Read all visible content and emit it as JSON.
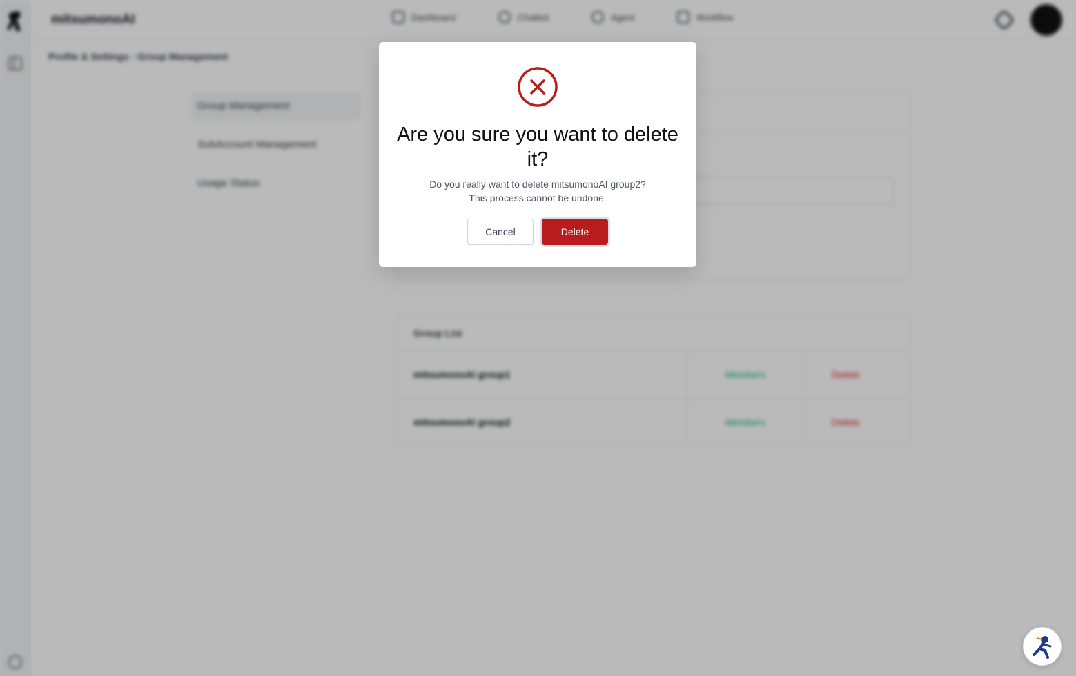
{
  "app": {
    "brand": "mitsumonoAI",
    "nav": [
      {
        "label": "Dashboard",
        "icon": "home-icon"
      },
      {
        "label": "Chatbot",
        "icon": "chat-icon"
      },
      {
        "label": "Agent",
        "icon": "globe-icon"
      },
      {
        "label": "Workflow",
        "icon": "share-icon"
      }
    ],
    "breadcrumb": "Profile & Settings - Group Management"
  },
  "settings_menu": [
    {
      "label": "Group Management",
      "active": true
    },
    {
      "label": "SubAccount Management",
      "active": false
    },
    {
      "label": "Usage Status",
      "active": false
    }
  ],
  "group_list": {
    "title": "Group List",
    "rows": [
      {
        "name": "mitsumonoAI group1",
        "members_label": "Members",
        "delete_label": "Delete"
      },
      {
        "name": "mitsumonoAI group2",
        "members_label": "Members",
        "delete_label": "Delete"
      }
    ]
  },
  "modal": {
    "title": "Are you sure you want to delete it?",
    "message_line1": "Do you really want to delete mitsumonoAI group2?",
    "message_line2": "This process cannot be undone.",
    "cancel_label": "Cancel",
    "delete_label": "Delete",
    "icon": "x-circle-icon"
  },
  "colors": {
    "danger": "#b91c1c",
    "overlay": "rgba(0,0,0,0.27)",
    "success": "#10b981"
  }
}
